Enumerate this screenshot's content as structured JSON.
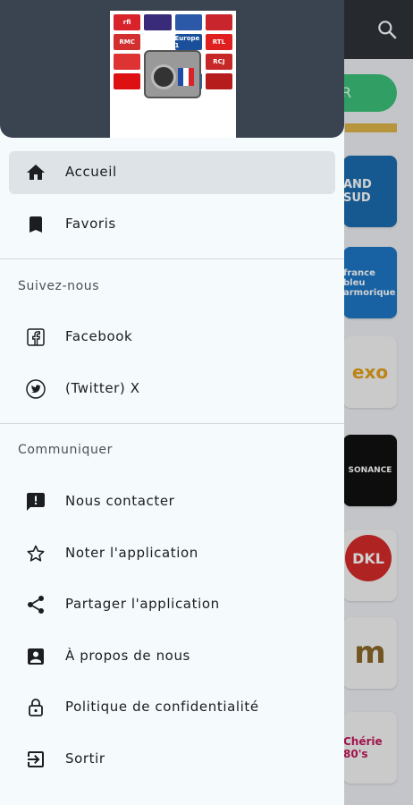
{
  "background": {
    "action_button_label": "R",
    "cards": [
      {
        "text": "AND SUD"
      },
      {
        "text": "france bleu armorique"
      },
      {
        "text": "exo"
      },
      {
        "text": "SONANCE"
      },
      {
        "text": "DKL"
      },
      {
        "text": "m"
      },
      {
        "text": "Chérie 80's"
      }
    ]
  },
  "drawer": {
    "logo_tiles": [
      "rfi",
      "",
      "",
      "",
      "RMC",
      "",
      "Europe 1",
      "RTL",
      "",
      "",
      "",
      "RCJ",
      "",
      "",
      "",
      ""
    ],
    "primary": [
      {
        "label": "Accueil",
        "icon": "home-icon",
        "active": true
      },
      {
        "label": "Favoris",
        "icon": "bookmark-icon",
        "active": false
      }
    ],
    "follow_section": {
      "title": "Suivez-nous",
      "items": [
        {
          "label": "Facebook",
          "icon": "facebook-icon"
        },
        {
          "label": "(Twitter) X",
          "icon": "twitter-icon"
        }
      ]
    },
    "communicate_section": {
      "title": "Communiquer",
      "items": [
        {
          "label": "Nous contacter",
          "icon": "feedback-icon"
        },
        {
          "label": "Noter l'application",
          "icon": "star-icon"
        },
        {
          "label": "Partager l'application",
          "icon": "share-icon"
        },
        {
          "label": "À propos de nous",
          "icon": "account-box-icon"
        },
        {
          "label": "Politique de confidentialité",
          "icon": "lock-icon"
        },
        {
          "label": "Sortir",
          "icon": "exit-icon"
        }
      ]
    }
  },
  "colors": {
    "drawer_bg": "#f5fafd",
    "header_bg": "#3a4350",
    "active_bg": "#dde3e7",
    "topbar_bg": "#2f343a",
    "accent_green": "#3cc27a"
  }
}
